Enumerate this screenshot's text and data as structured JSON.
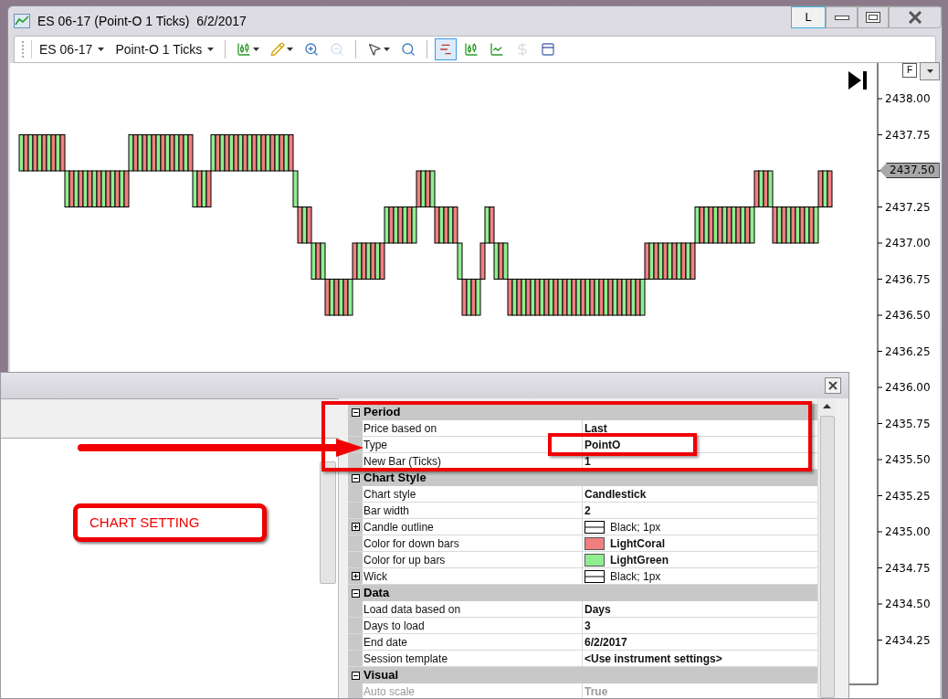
{
  "window": {
    "title": "ES 06-17 (Point-O 1 Ticks)  6/2/2017",
    "lock_button": "L"
  },
  "toolbar": {
    "instrument": "ES 06-17",
    "period": "Point-O 1 Ticks",
    "tools": [
      {
        "kind": "candles",
        "menu": true,
        "separator_before": true,
        "selected": false,
        "disabled": false
      },
      {
        "kind": "pencil",
        "menu": true,
        "separator_before": false,
        "selected": false,
        "disabled": false
      },
      {
        "kind": "zoom-in",
        "menu": false,
        "separator_before": false,
        "selected": false,
        "disabled": false
      },
      {
        "kind": "zoom-out",
        "menu": false,
        "separator_before": false,
        "selected": false,
        "disabled": true
      },
      {
        "kind": "pointer",
        "menu": true,
        "separator_before": true,
        "selected": false,
        "disabled": false
      },
      {
        "kind": "magnifier",
        "menu": false,
        "separator_before": false,
        "selected": false,
        "disabled": false
      },
      {
        "kind": "bar-type",
        "menu": false,
        "separator_before": true,
        "selected": true,
        "disabled": false
      },
      {
        "kind": "candles",
        "menu": false,
        "separator_before": false,
        "selected": false,
        "disabled": false
      },
      {
        "kind": "line-chart",
        "menu": false,
        "separator_before": false,
        "selected": false,
        "disabled": false
      },
      {
        "kind": "dollar",
        "menu": false,
        "separator_before": false,
        "selected": false,
        "disabled": true
      },
      {
        "kind": "panel",
        "menu": false,
        "separator_before": false,
        "selected": false,
        "disabled": false
      }
    ]
  },
  "chart": {
    "scale_button": "F",
    "price_axis": [
      {
        "kind": "tick",
        "label": "2438.00"
      },
      {
        "kind": "tick",
        "label": "2437.75"
      },
      {
        "kind": "last-price",
        "label": "2437.50"
      },
      {
        "kind": "tick",
        "label": "2437.25"
      },
      {
        "kind": "tick",
        "label": "2437.00"
      },
      {
        "kind": "tick",
        "label": "2436.75"
      },
      {
        "kind": "tick",
        "label": "2436.50"
      },
      {
        "kind": "tick",
        "label": "2436.25"
      },
      {
        "kind": "tick",
        "label": "2436.00"
      },
      {
        "kind": "tick",
        "label": "2435.75"
      },
      {
        "kind": "tick",
        "label": "2435.50"
      },
      {
        "kind": "tick",
        "label": "2435.25"
      },
      {
        "kind": "tick",
        "label": "2435.00"
      },
      {
        "kind": "tick",
        "label": "2434.75"
      },
      {
        "kind": "tick",
        "label": "2434.50"
      },
      {
        "kind": "tick",
        "label": "2434.25"
      }
    ]
  },
  "dialog": {
    "sections": [
      {
        "title": "Period",
        "expanded": true,
        "rows": [
          {
            "kind": "text",
            "name": "Price based on",
            "value": "Last",
            "expandable": false,
            "disabled": false
          },
          {
            "kind": "text",
            "name": "Type",
            "value": "PointO",
            "expandable": false,
            "disabled": false
          },
          {
            "kind": "text",
            "name": "New Bar (Ticks)",
            "value": "1",
            "expandable": false,
            "disabled": false
          }
        ]
      },
      {
        "title": "Chart Style",
        "expanded": true,
        "rows": [
          {
            "kind": "text",
            "name": "Chart style",
            "value": "Candlestick",
            "expandable": false,
            "disabled": false
          },
          {
            "kind": "text",
            "name": "Bar width",
            "value": "2",
            "expandable": false,
            "disabled": false
          },
          {
            "kind": "line",
            "name": "Candle outline",
            "value": "Black; 1px",
            "expandable": true,
            "disabled": false
          },
          {
            "kind": "color",
            "name": "Color for down bars",
            "value": "LightCoral",
            "color": "#f08080",
            "expandable": false,
            "disabled": false
          },
          {
            "kind": "color",
            "name": "Color for up bars",
            "value": "LightGreen",
            "color": "#90ee90",
            "expandable": false,
            "disabled": false
          },
          {
            "kind": "line",
            "name": "Wick",
            "value": "Black; 1px",
            "expandable": true,
            "disabled": false
          }
        ]
      },
      {
        "title": "Data",
        "expanded": true,
        "rows": [
          {
            "kind": "text",
            "name": "Load data based on",
            "value": "Days",
            "expandable": false,
            "disabled": false
          },
          {
            "kind": "text",
            "name": "Days to load",
            "value": "3",
            "expandable": false,
            "disabled": false
          },
          {
            "kind": "text",
            "name": "End date",
            "value": "6/2/2017",
            "expandable": false,
            "disabled": false
          },
          {
            "kind": "text",
            "name": "Session template",
            "value": "<Use instrument settings>",
            "expandable": false,
            "disabled": false
          }
        ]
      },
      {
        "title": "Visual",
        "expanded": true,
        "rows": [
          {
            "kind": "text",
            "name": "Auto scale",
            "value": "True",
            "expandable": false,
            "disabled": true
          }
        ]
      }
    ]
  },
  "annotation": {
    "label": "CHART SETTING"
  }
}
